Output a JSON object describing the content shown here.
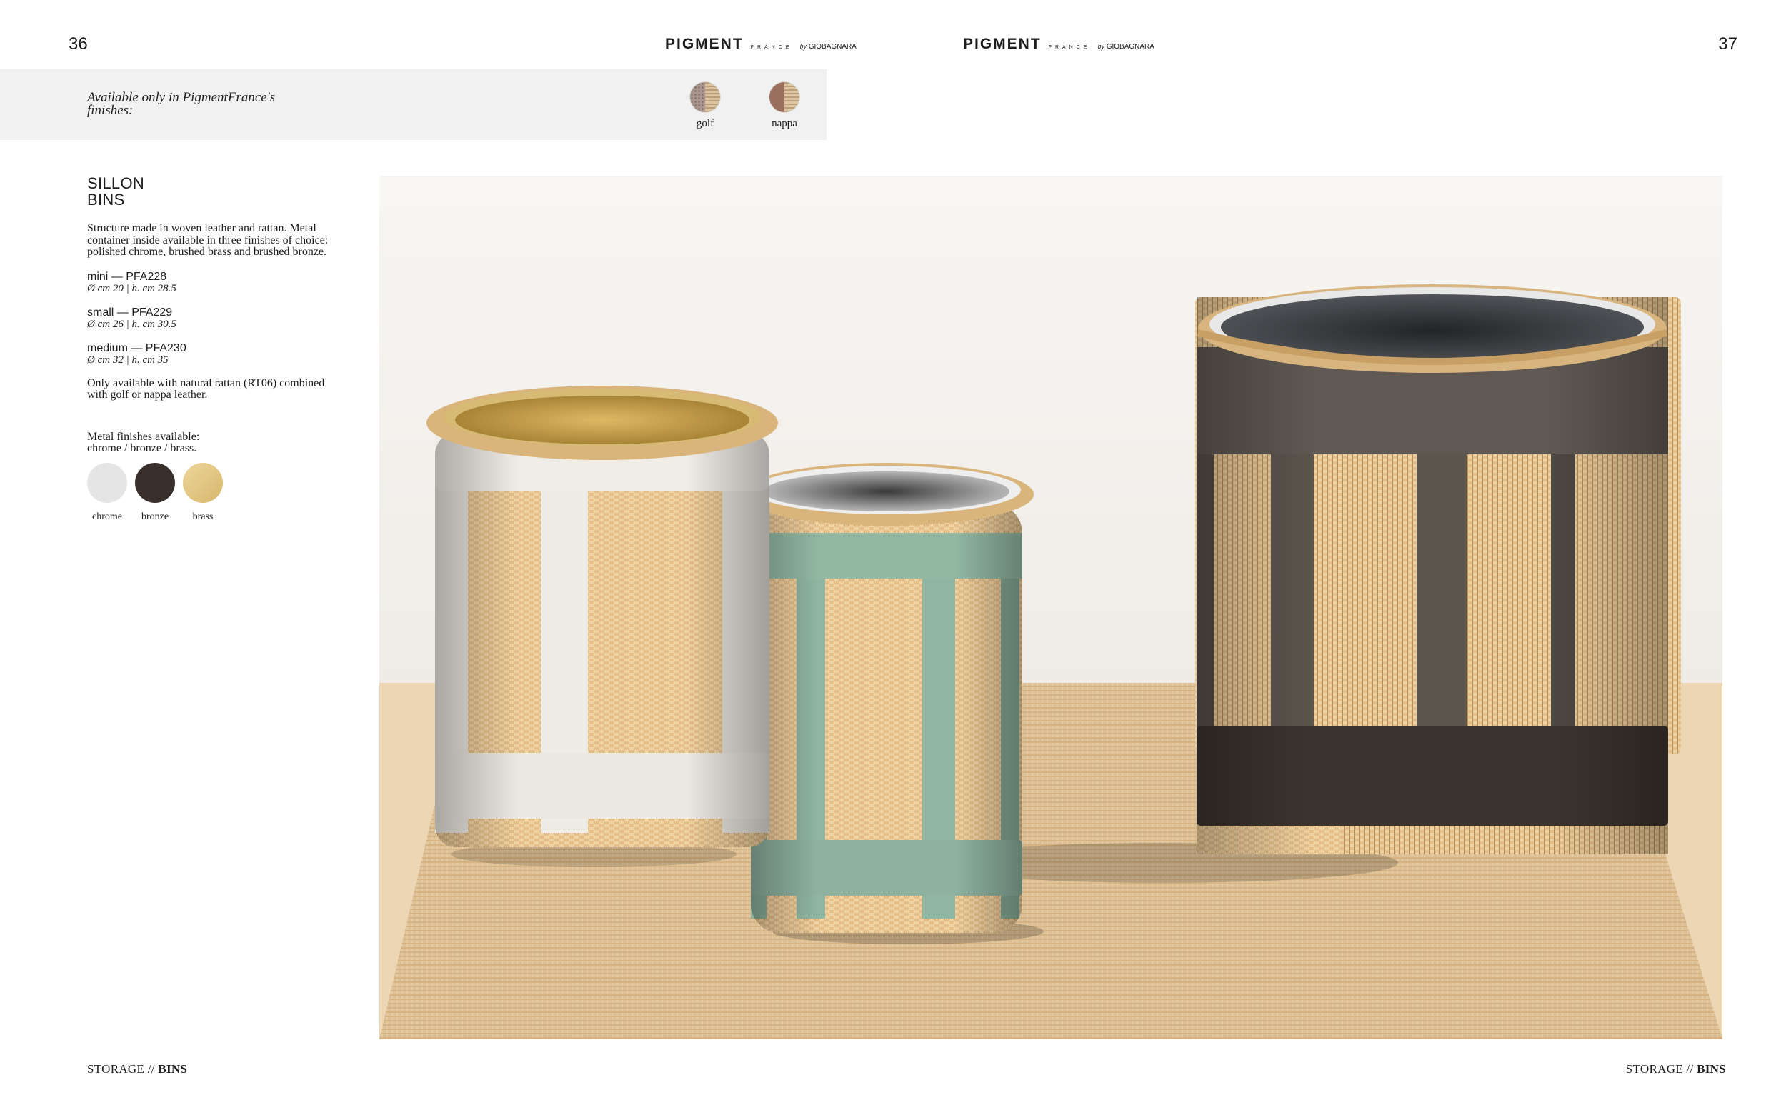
{
  "pages": {
    "left": "36",
    "right": "37"
  },
  "brand": {
    "name": "PIGMENT",
    "sub": "FRANCE",
    "by": "by",
    "maker": "GIOBAGNARA"
  },
  "finishes": {
    "title": "Available only in PigmentFrance's finishes:",
    "items": [
      {
        "label": "golf",
        "colors": [
          "#a9968e",
          "#d9c3a1"
        ]
      },
      {
        "label": "nappa",
        "colors": [
          "#9b6f5d",
          "#dcc6a4"
        ]
      }
    ]
  },
  "product": {
    "title_line1": "SILLON",
    "title_line2": "BINS",
    "description": "Structure made in woven leather and rattan. Metal container inside available in three finishes of choice: polished chrome, brushed brass and brushed bronze.",
    "sizes": [
      {
        "code": "mini — PFA228",
        "dims": "Ø cm 20 | h. cm 28.5"
      },
      {
        "code": "small — PFA229",
        "dims": "Ø cm 26 | h. cm 30.5"
      },
      {
        "code": "medium — PFA230",
        "dims": "Ø cm 32 | h. cm 35"
      }
    ],
    "note": "Only available with natural rattan (RT06) combined with golf or nappa leather.",
    "metal_title_line1": "Metal finishes available:",
    "metal_title_line2": "chrome / bronze / brass.",
    "metals": [
      {
        "label": "chrome",
        "color": "#e5e5e5"
      },
      {
        "label": "bronze",
        "color": "#3a302b"
      },
      {
        "label": "brass",
        "color": "#e2c886"
      }
    ]
  },
  "footer": {
    "left": {
      "section": "STORAGE",
      "sep": " // ",
      "sub": "BINS"
    },
    "right": {
      "section": "STORAGE",
      "sep": " // ",
      "sub": "BINS"
    }
  }
}
